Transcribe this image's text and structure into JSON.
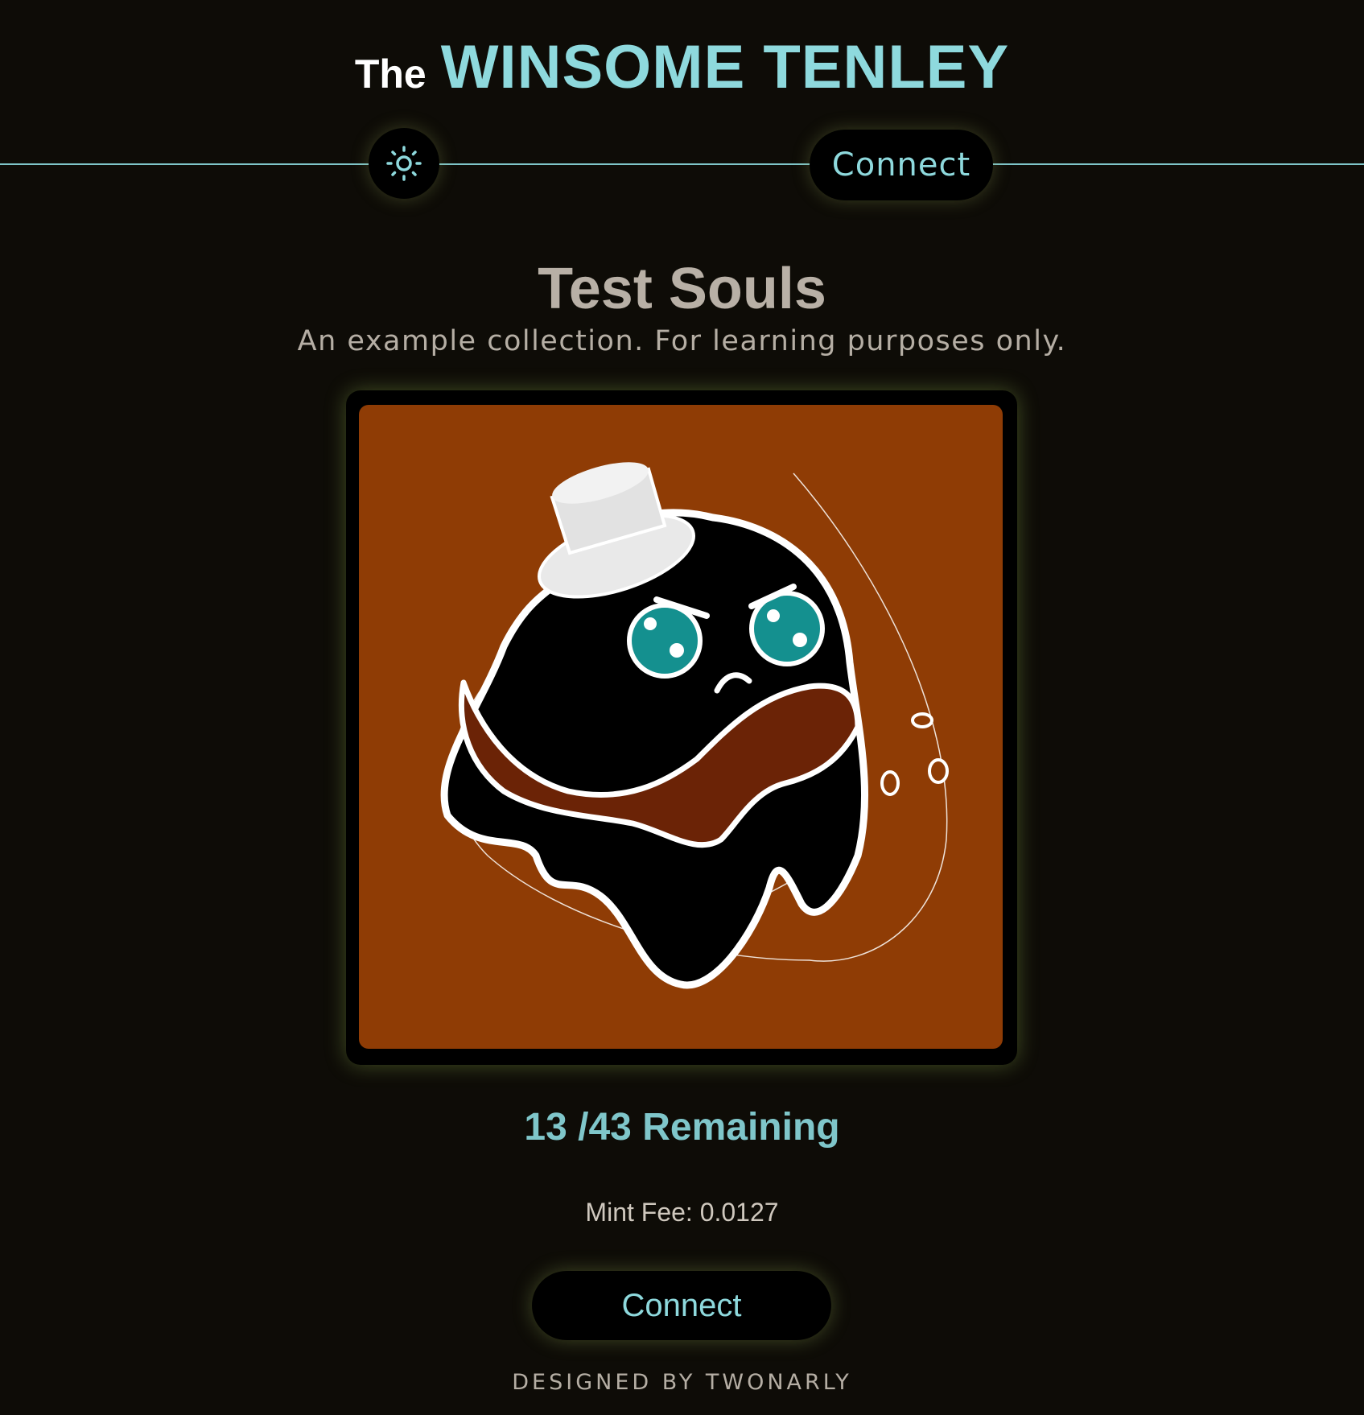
{
  "header": {
    "title_prefix": "The",
    "title_main": "WINSOME TENLEY"
  },
  "nav": {
    "theme_toggle_icon": "sun-icon",
    "connect_label": "Connect"
  },
  "collection": {
    "name": "Test Souls",
    "description": "An example collection. For learning purposes only."
  },
  "artwork": {
    "subject": "ghost-character-icon",
    "background_color": "#8f3c05"
  },
  "mint": {
    "remaining_text": "13 /43 Remaining",
    "remaining": 13,
    "total": 43,
    "fee_text": "Mint Fee: 0.0127",
    "connect_label": "Connect"
  },
  "footer": {
    "credit": "DESIGNED BY TWONARLY"
  },
  "colors": {
    "background": "#0e0c07",
    "accent": "#8ed9dd",
    "text_muted": "#b5aea4"
  }
}
